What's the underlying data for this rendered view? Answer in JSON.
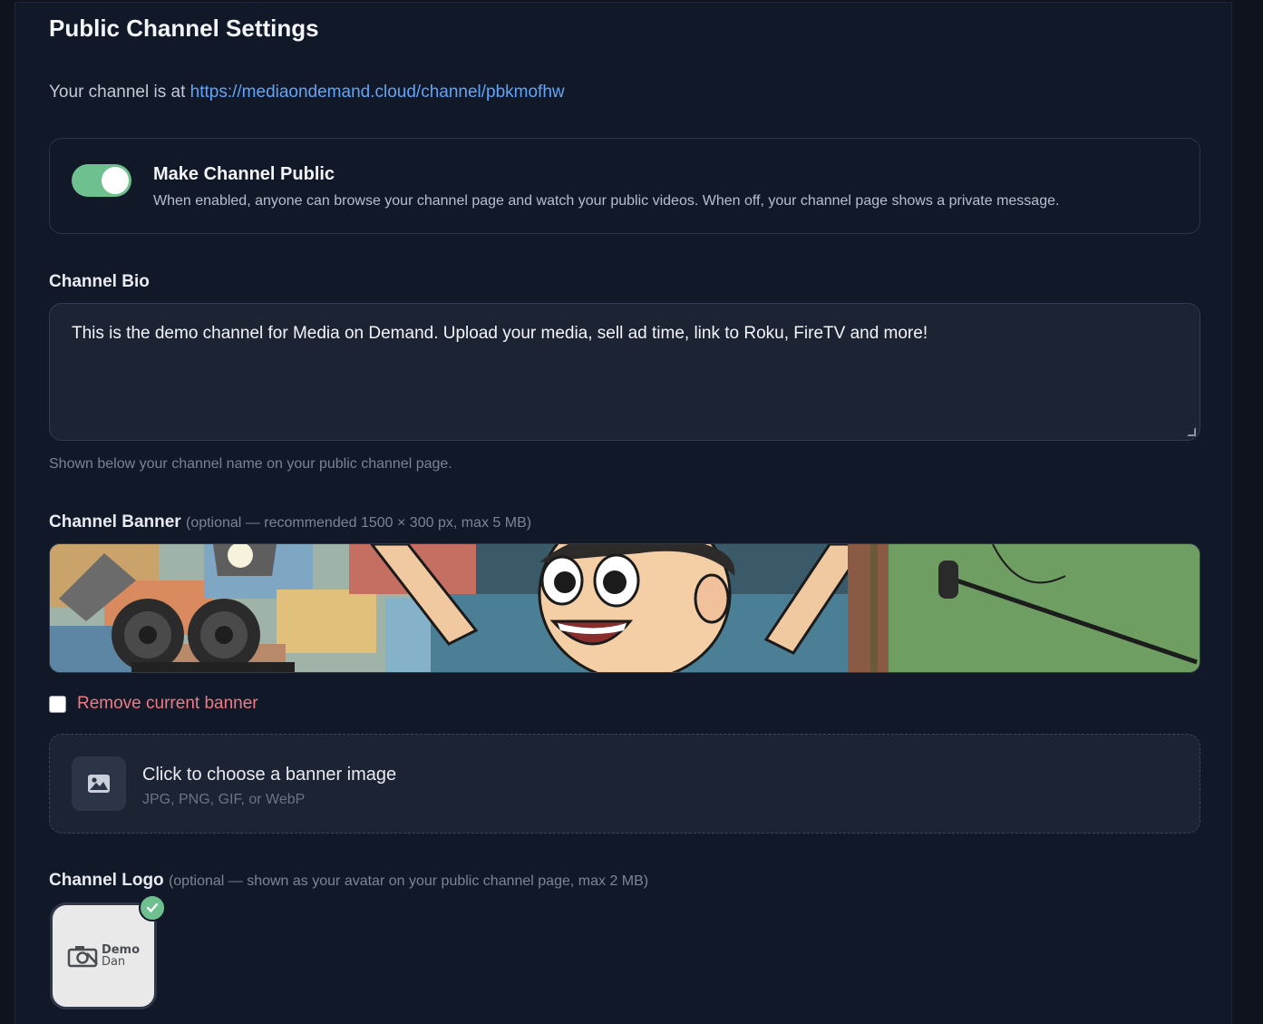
{
  "page": {
    "title": "Public Channel Settings",
    "channel_url_prefix": "Your channel is at ",
    "channel_url": "https://mediaondemand.cloud/channel/pbkmofhw"
  },
  "public_toggle": {
    "enabled": true,
    "title": "Make Channel Public",
    "description": "When enabled, anyone can browse your channel page and watch your public videos. When off, your channel page shows a private message."
  },
  "bio": {
    "label": "Channel Bio",
    "value": "This is the demo channel for Media on Demand. Upload your media, sell ad time, link to Roku, FireTV and more!",
    "hint": "Shown below your channel name on your public channel page."
  },
  "banner": {
    "label": "Channel Banner",
    "optional_note": "(optional — recommended 1500 × 300 px, max 5 MB)",
    "remove_label": "Remove current banner",
    "remove_checked": false,
    "upload_title": "Click to choose a banner image",
    "upload_formats": "JPG, PNG, GIF, or WebP",
    "upload_icon": "image-icon"
  },
  "logo": {
    "label": "Channel Logo",
    "optional_note": "(optional — shown as your avatar on your public channel page, max 2 MB)",
    "logo_text_line1": "Demo",
    "logo_text_line2": "Dan",
    "status_icon": "check-icon"
  },
  "colors": {
    "accent_link": "#60a5fa",
    "toggle_on": "#6ec18f",
    "danger_text": "#f07a84"
  }
}
